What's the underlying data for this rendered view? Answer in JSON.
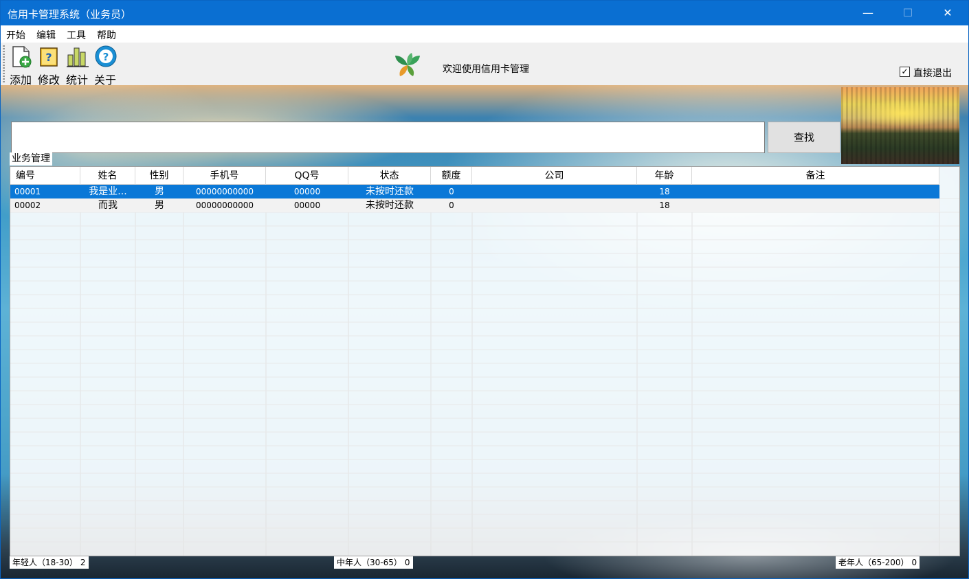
{
  "window": {
    "title": "信用卡管理系统（业务员）",
    "controls": {
      "minimize": "—",
      "maximize": "☐",
      "close": "✕"
    }
  },
  "menu": [
    "开始",
    "编辑",
    "工具",
    "帮助"
  ],
  "toolbar": {
    "buttons": [
      {
        "label": "添加",
        "icon": "add-file-icon"
      },
      {
        "label": "修改",
        "icon": "edit-file-icon"
      },
      {
        "label": "统计",
        "icon": "bar-chart-icon"
      },
      {
        "label": "关于",
        "icon": "help-icon"
      }
    ],
    "welcome": "欢迎使用信用卡管理",
    "direct_exit_label": "直接退出",
    "direct_exit_checked": true
  },
  "search": {
    "value": "",
    "button_label": "查找"
  },
  "group_label": "业务管理",
  "table": {
    "columns": [
      "编号",
      "姓名",
      "性别",
      "手机号",
      "QQ号",
      "状态",
      "额度",
      "公司",
      "年龄",
      "备注"
    ],
    "rows": [
      [
        "00001",
        "我是业...",
        "男",
        "00000000000",
        "00000",
        "未按时还款",
        "0",
        "",
        "18",
        ""
      ],
      [
        "00002",
        "而我",
        "男",
        "00000000000",
        "00000",
        "未按时还款",
        "0",
        "",
        "18",
        ""
      ]
    ],
    "selected_row": 0
  },
  "status": {
    "young": {
      "label": "年轻人（18-30）",
      "count": "2"
    },
    "middle": {
      "label": "中年人（30-65）",
      "count": "0"
    },
    "old": {
      "label": "老年人（65-200）",
      "count": "0"
    }
  },
  "colors": {
    "titlebar": "#0a6fd2",
    "selection": "#0a78d7"
  }
}
